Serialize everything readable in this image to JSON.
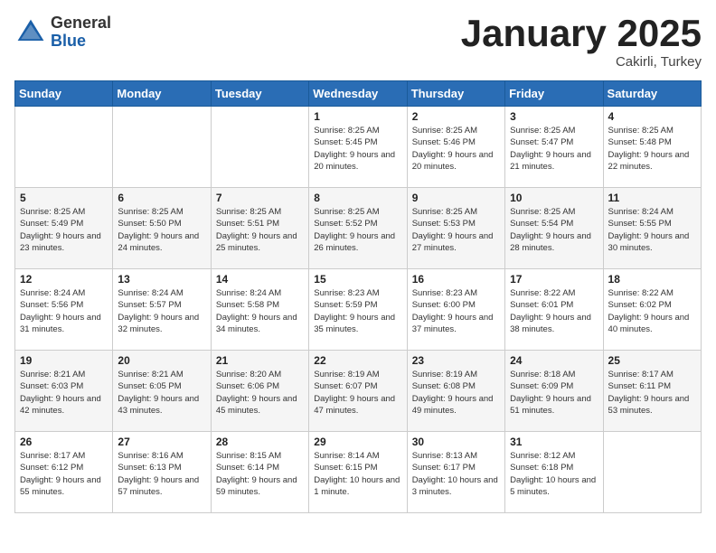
{
  "header": {
    "logo_general": "General",
    "logo_blue": "Blue",
    "month_title": "January 2025",
    "subtitle": "Cakirli, Turkey"
  },
  "weekdays": [
    "Sunday",
    "Monday",
    "Tuesday",
    "Wednesday",
    "Thursday",
    "Friday",
    "Saturday"
  ],
  "weeks": [
    [
      {
        "day": "",
        "info": ""
      },
      {
        "day": "",
        "info": ""
      },
      {
        "day": "",
        "info": ""
      },
      {
        "day": "1",
        "info": "Sunrise: 8:25 AM\nSunset: 5:45 PM\nDaylight: 9 hours and 20 minutes."
      },
      {
        "day": "2",
        "info": "Sunrise: 8:25 AM\nSunset: 5:46 PM\nDaylight: 9 hours and 20 minutes."
      },
      {
        "day": "3",
        "info": "Sunrise: 8:25 AM\nSunset: 5:47 PM\nDaylight: 9 hours and 21 minutes."
      },
      {
        "day": "4",
        "info": "Sunrise: 8:25 AM\nSunset: 5:48 PM\nDaylight: 9 hours and 22 minutes."
      }
    ],
    [
      {
        "day": "5",
        "info": "Sunrise: 8:25 AM\nSunset: 5:49 PM\nDaylight: 9 hours and 23 minutes."
      },
      {
        "day": "6",
        "info": "Sunrise: 8:25 AM\nSunset: 5:50 PM\nDaylight: 9 hours and 24 minutes."
      },
      {
        "day": "7",
        "info": "Sunrise: 8:25 AM\nSunset: 5:51 PM\nDaylight: 9 hours and 25 minutes."
      },
      {
        "day": "8",
        "info": "Sunrise: 8:25 AM\nSunset: 5:52 PM\nDaylight: 9 hours and 26 minutes."
      },
      {
        "day": "9",
        "info": "Sunrise: 8:25 AM\nSunset: 5:53 PM\nDaylight: 9 hours and 27 minutes."
      },
      {
        "day": "10",
        "info": "Sunrise: 8:25 AM\nSunset: 5:54 PM\nDaylight: 9 hours and 28 minutes."
      },
      {
        "day": "11",
        "info": "Sunrise: 8:24 AM\nSunset: 5:55 PM\nDaylight: 9 hours and 30 minutes."
      }
    ],
    [
      {
        "day": "12",
        "info": "Sunrise: 8:24 AM\nSunset: 5:56 PM\nDaylight: 9 hours and 31 minutes."
      },
      {
        "day": "13",
        "info": "Sunrise: 8:24 AM\nSunset: 5:57 PM\nDaylight: 9 hours and 32 minutes."
      },
      {
        "day": "14",
        "info": "Sunrise: 8:24 AM\nSunset: 5:58 PM\nDaylight: 9 hours and 34 minutes."
      },
      {
        "day": "15",
        "info": "Sunrise: 8:23 AM\nSunset: 5:59 PM\nDaylight: 9 hours and 35 minutes."
      },
      {
        "day": "16",
        "info": "Sunrise: 8:23 AM\nSunset: 6:00 PM\nDaylight: 9 hours and 37 minutes."
      },
      {
        "day": "17",
        "info": "Sunrise: 8:22 AM\nSunset: 6:01 PM\nDaylight: 9 hours and 38 minutes."
      },
      {
        "day": "18",
        "info": "Sunrise: 8:22 AM\nSunset: 6:02 PM\nDaylight: 9 hours and 40 minutes."
      }
    ],
    [
      {
        "day": "19",
        "info": "Sunrise: 8:21 AM\nSunset: 6:03 PM\nDaylight: 9 hours and 42 minutes."
      },
      {
        "day": "20",
        "info": "Sunrise: 8:21 AM\nSunset: 6:05 PM\nDaylight: 9 hours and 43 minutes."
      },
      {
        "day": "21",
        "info": "Sunrise: 8:20 AM\nSunset: 6:06 PM\nDaylight: 9 hours and 45 minutes."
      },
      {
        "day": "22",
        "info": "Sunrise: 8:19 AM\nSunset: 6:07 PM\nDaylight: 9 hours and 47 minutes."
      },
      {
        "day": "23",
        "info": "Sunrise: 8:19 AM\nSunset: 6:08 PM\nDaylight: 9 hours and 49 minutes."
      },
      {
        "day": "24",
        "info": "Sunrise: 8:18 AM\nSunset: 6:09 PM\nDaylight: 9 hours and 51 minutes."
      },
      {
        "day": "25",
        "info": "Sunrise: 8:17 AM\nSunset: 6:11 PM\nDaylight: 9 hours and 53 minutes."
      }
    ],
    [
      {
        "day": "26",
        "info": "Sunrise: 8:17 AM\nSunset: 6:12 PM\nDaylight: 9 hours and 55 minutes."
      },
      {
        "day": "27",
        "info": "Sunrise: 8:16 AM\nSunset: 6:13 PM\nDaylight: 9 hours and 57 minutes."
      },
      {
        "day": "28",
        "info": "Sunrise: 8:15 AM\nSunset: 6:14 PM\nDaylight: 9 hours and 59 minutes."
      },
      {
        "day": "29",
        "info": "Sunrise: 8:14 AM\nSunset: 6:15 PM\nDaylight: 10 hours and 1 minute."
      },
      {
        "day": "30",
        "info": "Sunrise: 8:13 AM\nSunset: 6:17 PM\nDaylight: 10 hours and 3 minutes."
      },
      {
        "day": "31",
        "info": "Sunrise: 8:12 AM\nSunset: 6:18 PM\nDaylight: 10 hours and 5 minutes."
      },
      {
        "day": "",
        "info": ""
      }
    ]
  ]
}
